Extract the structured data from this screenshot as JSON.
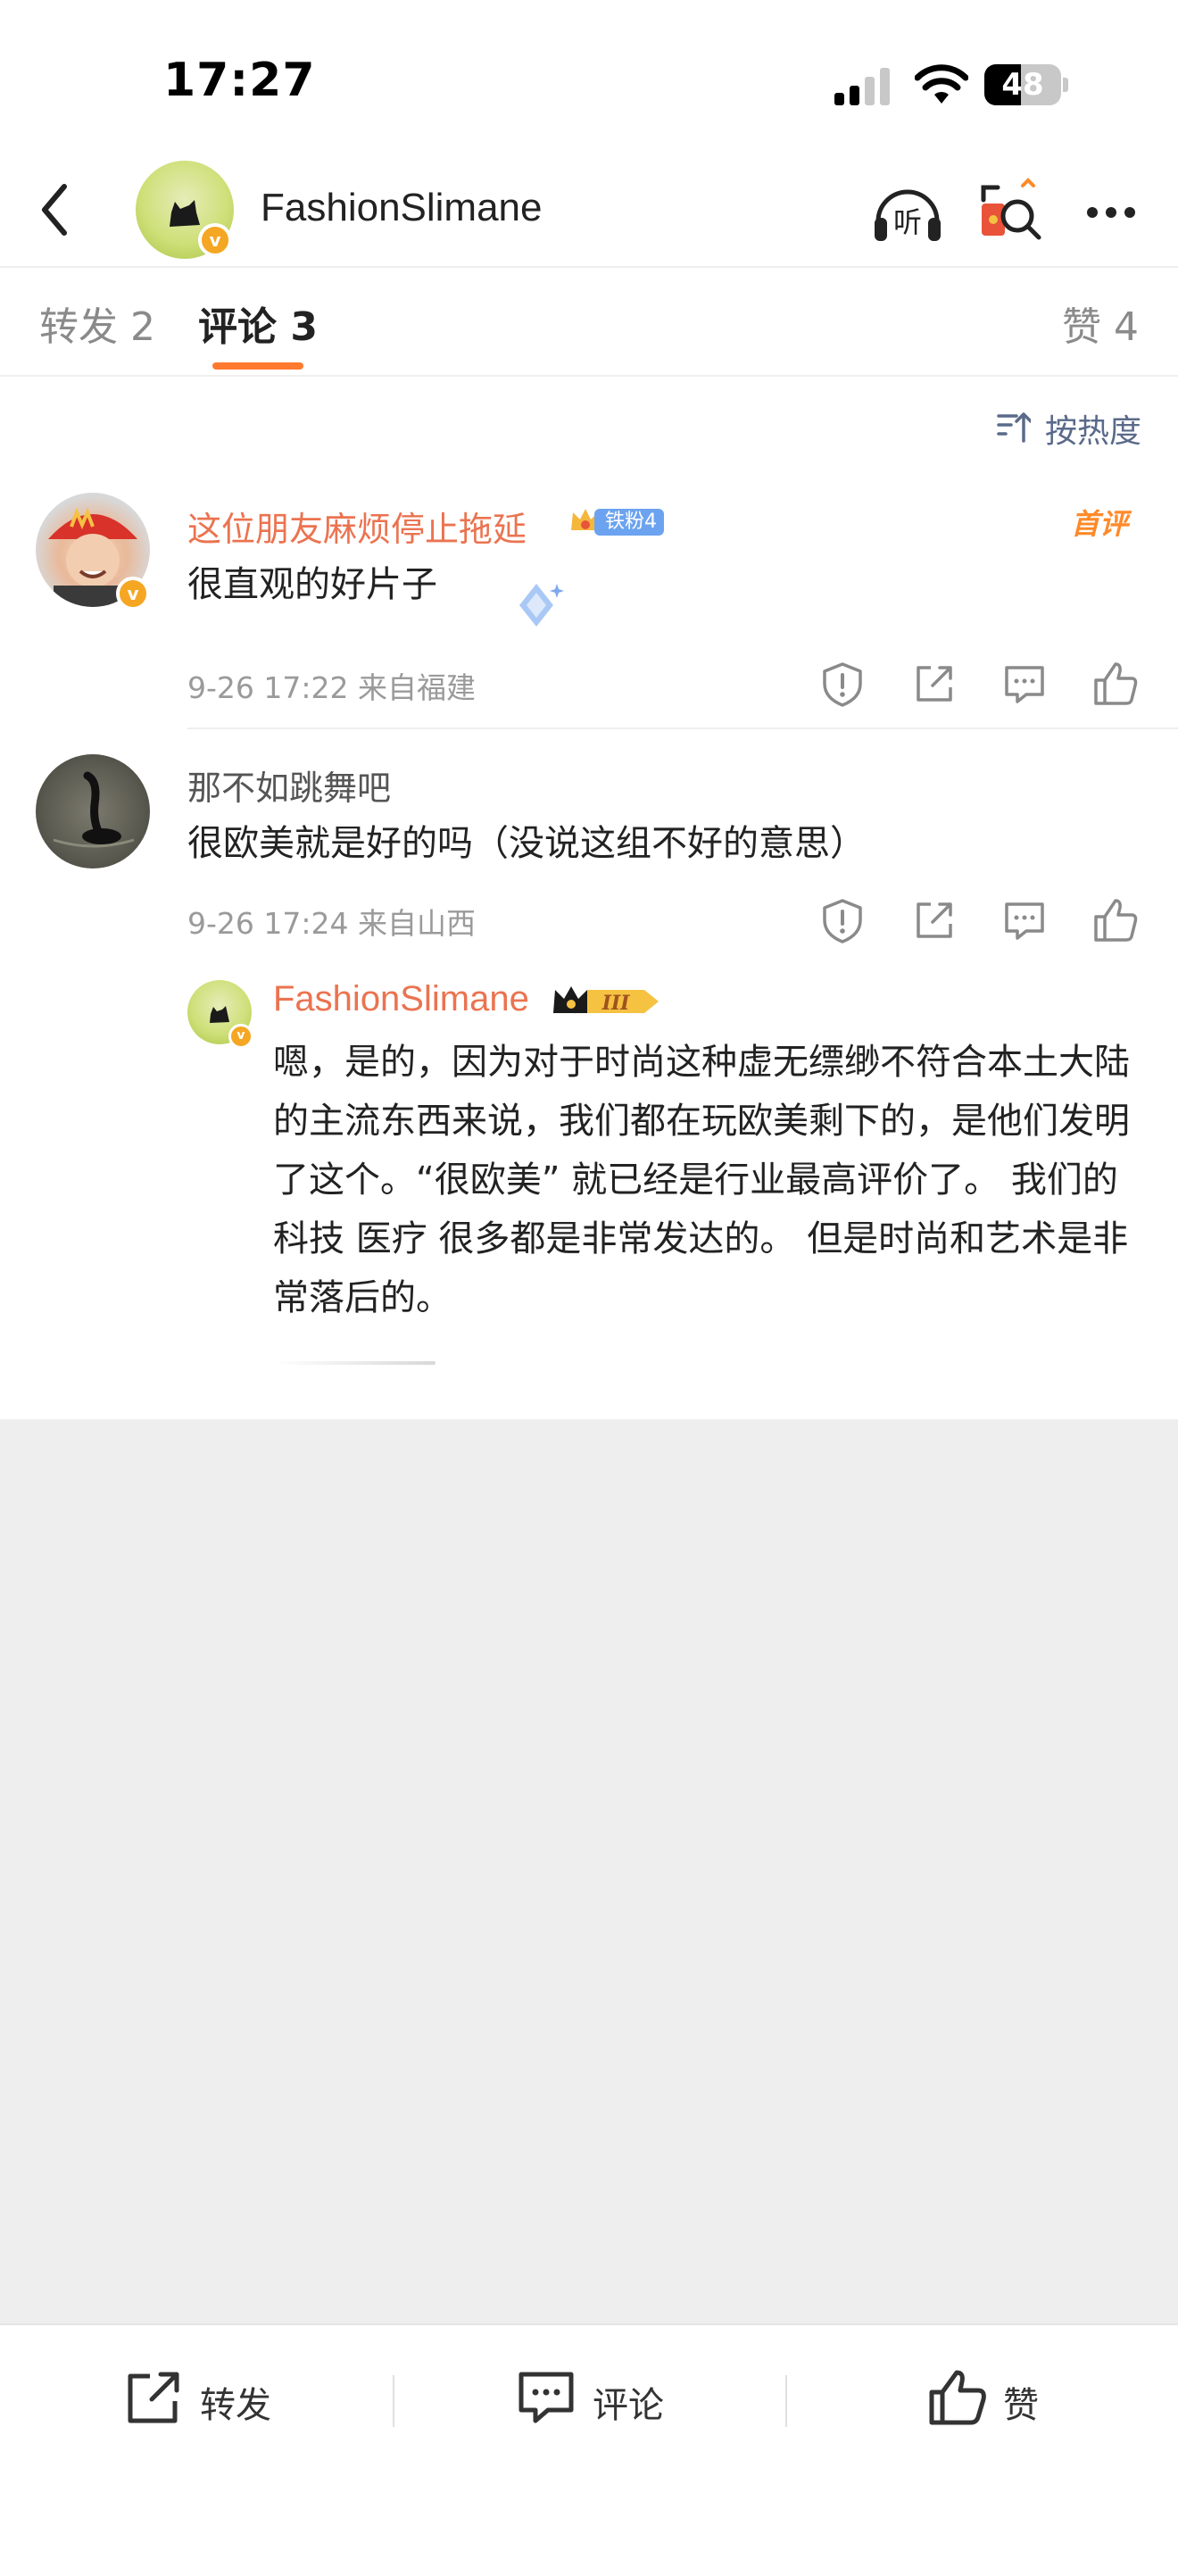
{
  "status_bar": {
    "time": "17:27",
    "battery_level": "48",
    "battery_fraction": 0.48
  },
  "header": {
    "name": "FashionSlimane",
    "listen_label": "听",
    "verified_badge": "v"
  },
  "tabs": [
    {
      "label": "转发 2",
      "active": false
    },
    {
      "label": "评论 3",
      "active": true
    },
    {
      "label": "赞 4",
      "active": false
    }
  ],
  "sort": {
    "label": "按热度"
  },
  "comments": [
    {
      "username": "这位朋友麻烦停止拖延",
      "fan_badge": "铁粉4",
      "first_tag": "首评",
      "text": "很直观的好片子",
      "meta": "9-26 17:22  来自福建"
    },
    {
      "username": "那不如跳舞吧",
      "text": "很欧美就是好的吗（没说这组不好的意思）",
      "meta": "9-26 17:24  来自山西",
      "reply": {
        "username": "FashionSlimane",
        "level_badge": "III",
        "text": "嗯，是的，因为对于时尚这种虚无缥缈不符合本土大陆的主流东西来说，我们都在玩欧美剩下的，是他们发明了这个。“很欧美” 就已经是行业最高评价了。 我们的科技 医疗 很多都是非常发达的。 但是时尚和艺术是非常落后的。"
      }
    }
  ],
  "bottom_bar": {
    "repost_label": "转发",
    "comment_label": "评论",
    "like_label": "赞"
  },
  "colors": {
    "accent_orange": "#eb7350",
    "tab_underline": "#ff7a2e",
    "gray_background": "#eeeeee"
  },
  "icons": [
    "back-arrow-icon",
    "headphones-icon",
    "red-packet-search-icon",
    "more-icon",
    "sort-icon",
    "report-icon",
    "share-icon",
    "comment-icon",
    "like-icon"
  ]
}
